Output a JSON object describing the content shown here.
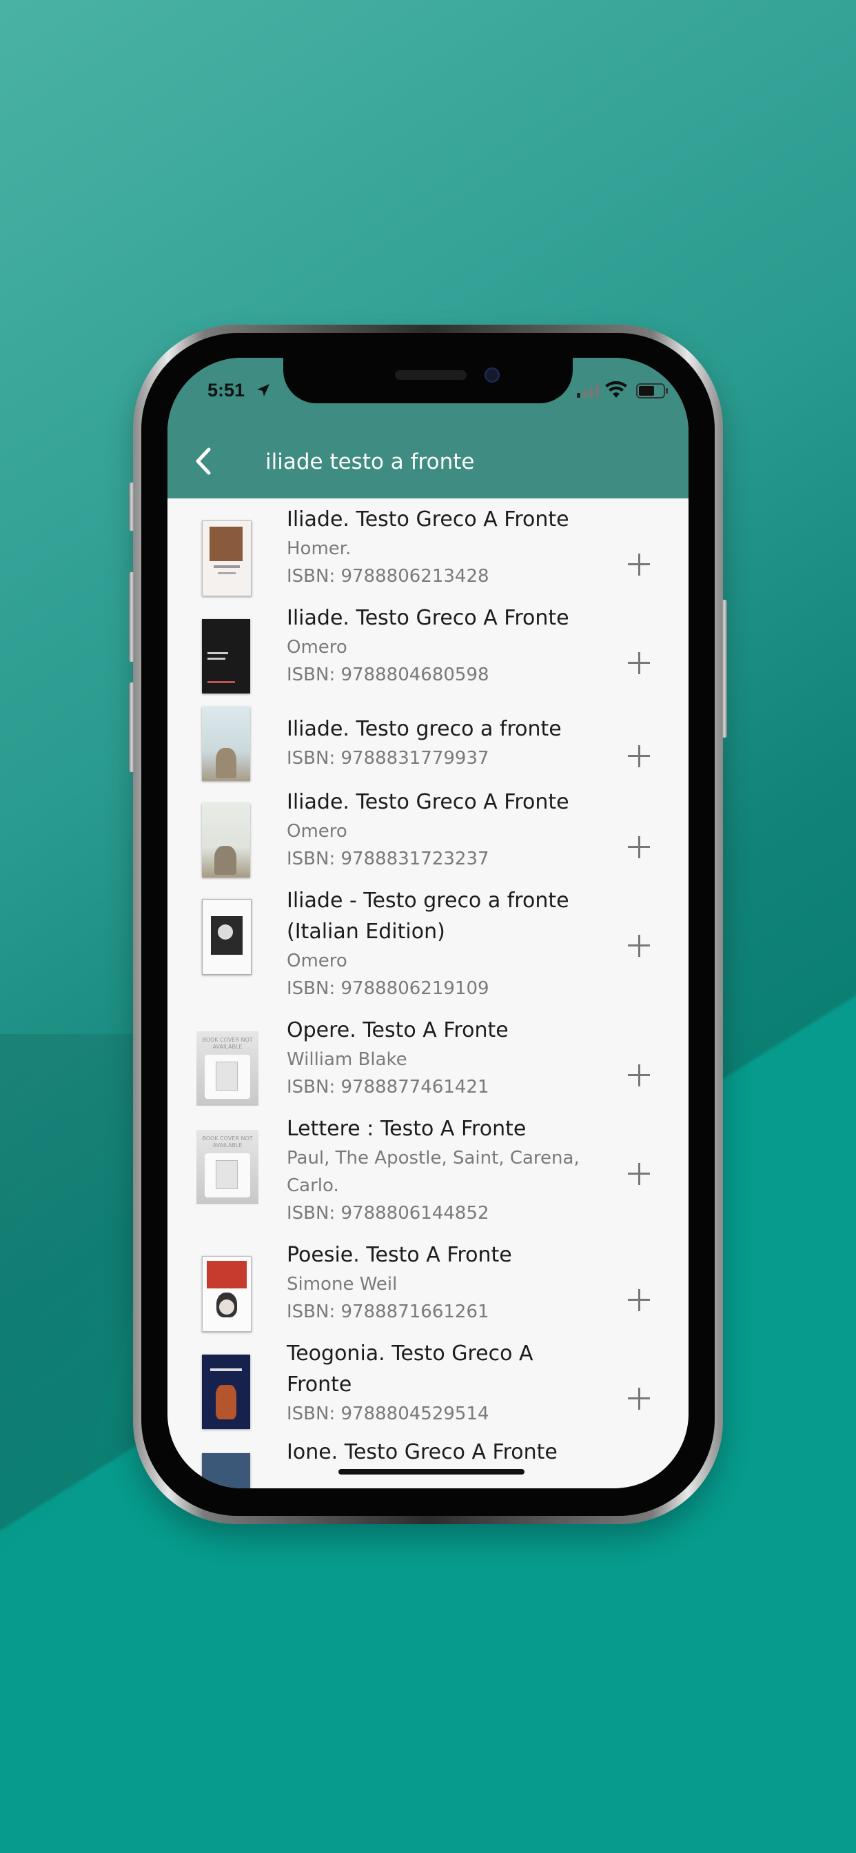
{
  "status_bar": {
    "time": "5:51"
  },
  "header": {
    "title": "iliade testo a fronte"
  },
  "colors": {
    "header": "#3f8c82",
    "background": "#069b8c",
    "list_bg": "#f7f7f7"
  },
  "results": [
    {
      "title": "Iliade. Testo Greco A Fronte",
      "author": "Homer.",
      "isbn": "ISBN: 9788806213428"
    },
    {
      "title": "Iliade. Testo Greco A Fronte",
      "author": "Omero",
      "isbn": "ISBN: 9788804680598"
    },
    {
      "title": "Iliade. Testo greco a fronte",
      "author": "",
      "isbn": "ISBN: 9788831779937"
    },
    {
      "title": "Iliade. Testo Greco A Fronte",
      "author": "Omero",
      "isbn": "ISBN: 9788831723237"
    },
    {
      "title": "Iliade - Testo greco a fronte (Italian Edition)",
      "author": "Omero",
      "isbn": "ISBN: 9788806219109"
    },
    {
      "title": "Opere. Testo A Fronte",
      "author": "William Blake",
      "isbn": "ISBN: 9788877461421"
    },
    {
      "title": "Lettere  : Testo A Fronte",
      "author": "Paul, The Apostle, Saint, Carena, Carlo.",
      "isbn": "ISBN: 9788806144852"
    },
    {
      "title": "Poesie. Testo A Fronte",
      "author": "Simone Weil",
      "isbn": "ISBN: 9788871661261"
    },
    {
      "title": "Teogonia. Testo Greco A Fronte",
      "author": "",
      "isbn": "ISBN: 9788804529514"
    },
    {
      "title": "Ione. Testo Greco A Fronte",
      "author": "",
      "isbn": ""
    }
  ],
  "placeholder_cover_text": "BOOK COVER NOT AVAILABLE"
}
